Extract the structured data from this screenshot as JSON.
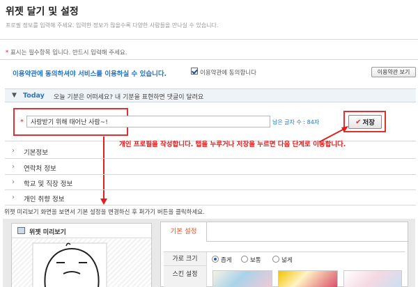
{
  "page": {
    "title": "위젯 달기 및 설정",
    "description": "프로필 정보를 입력해 주세요. 입력한 정보가 많을수록 다양한 사람들을 만나실 수 있습니다."
  },
  "required_note": {
    "star": "*",
    "text": " 표시는 필수항목 입니다. 반드시 입력해 주세요."
  },
  "terms": {
    "notice": "이용약관에 동의하셔야 서비스를 이용하실 수 있습니다.",
    "checkbox_label": "이용약관에 동의합니다",
    "checked": true,
    "view_button": "이용약관 보기"
  },
  "today": {
    "chevron": "▼",
    "title": "Today",
    "subtitle": "오늘 기분은 어떠세요? 내 기분을 표현하면 댓글이 달려요",
    "star": "*",
    "status_value": "사랑받기 위해 태어난 사람~!",
    "remaining": "남은 글자 수 : 84자",
    "save_icon": "✔",
    "save_label": "저장"
  },
  "annotation": "개인 프로필을 작성합니다. 탭을 누루거나 저장을 누르면 다음 단계로 이동합니다.",
  "sections": [
    {
      "chevron": "›",
      "label": "기본정보"
    },
    {
      "chevron": "›",
      "label": "연락처 정보"
    },
    {
      "chevron": "›",
      "label": "학교 및 직장 정보"
    },
    {
      "chevron": "›",
      "label": "개인 취향 정보"
    }
  ],
  "preview_note": "위젯 미리보기 화면을 보면서 기본 설정을 변경하신 후 퍼가기 버튼을 클릭하세요.",
  "widget_preview": {
    "title": "위젯 미리보기",
    "icon": "widget-window-icon"
  },
  "settings": {
    "tab_label": "기본 설정",
    "width_label": "가로 크기",
    "width_options": [
      "좁게",
      "보통",
      "넓게"
    ],
    "width_selected": "좁게",
    "skin_label": "스킨 설정"
  },
  "colors": {
    "accent_blue": "#1c73c7",
    "highlight_red": "#e02020",
    "tab_orange": "#e05018",
    "header_bg": "#eef3f7"
  }
}
